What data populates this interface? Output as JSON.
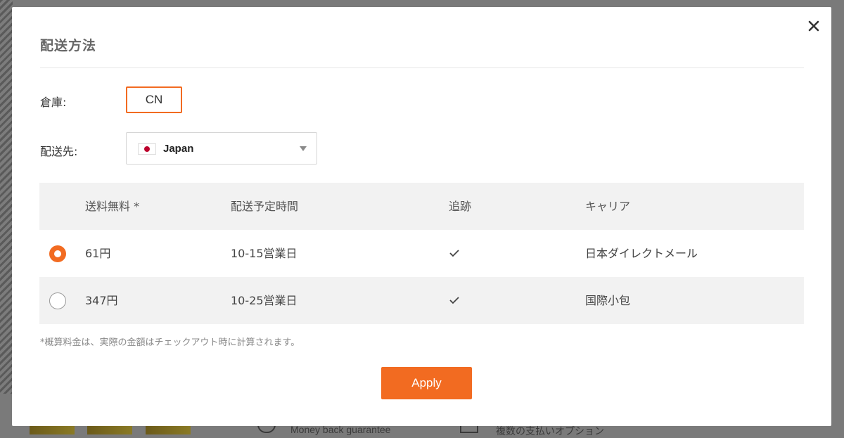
{
  "background": {
    "guarantee_text": "Money back guarantee",
    "payment_text": "複数の支払いオプション"
  },
  "modal": {
    "title": "配送方法",
    "close_icon": "close-icon",
    "warehouse_label": "倉庫:",
    "warehouse_value": "CN",
    "destination_label": "配送先:",
    "destination_value": "Japan",
    "destination_flag": "japan-flag-icon",
    "table": {
      "headers": {
        "price": "送料無料 *",
        "time": "配送予定時間",
        "tracking": "追跡",
        "carrier": "キャリア"
      },
      "rows": [
        {
          "selected": true,
          "price": "61円",
          "time": "10-15営業日",
          "tracking": true,
          "carrier": "日本ダイレクトメール"
        },
        {
          "selected": false,
          "price": "347円",
          "time": "10-25営業日",
          "tracking": true,
          "carrier": "国際小包"
        }
      ]
    },
    "note": "*概算料金は、実際の金額はチェックアウト時に計算されます。",
    "apply_label": "Apply"
  },
  "colors": {
    "accent": "#f26b21",
    "row_gray": "#f2f2f2",
    "overlay": "#7a7a7a"
  }
}
